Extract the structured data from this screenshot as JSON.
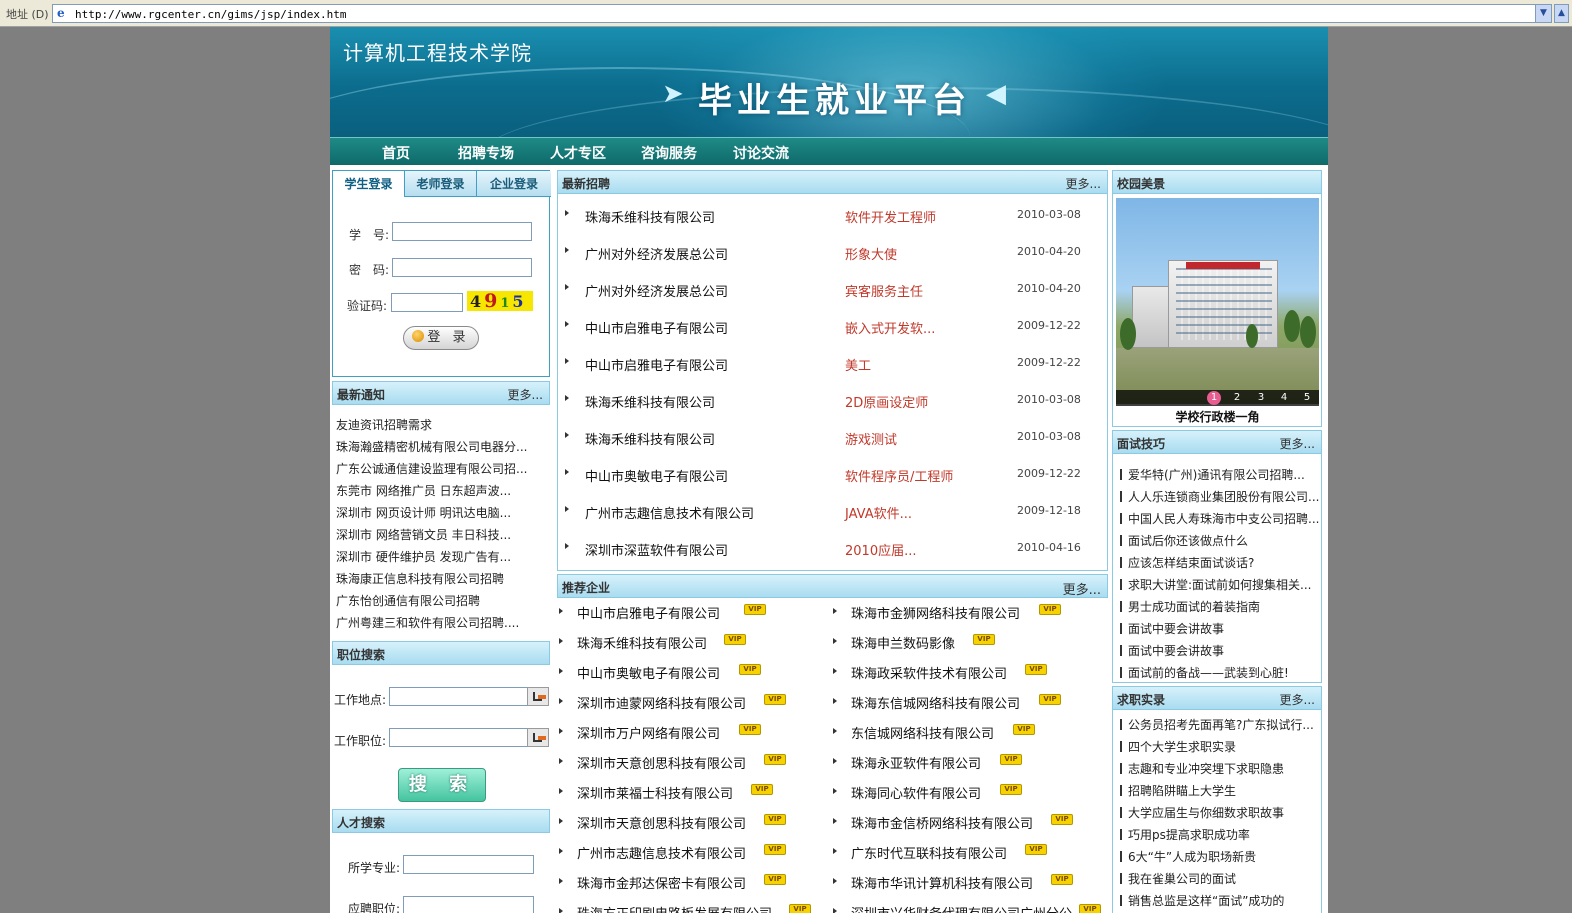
{
  "browser": {
    "address_label": "地址 (D)",
    "url": "http://www.rgcenter.cn/gims/jsp/index.htm"
  },
  "banner": {
    "school_name": "计算机工程技术学院",
    "platform_title": "毕业生就业平台"
  },
  "nav": {
    "items": [
      "首页",
      "招聘专场",
      "人才专区",
      "咨询服务",
      "讨论交流"
    ]
  },
  "login": {
    "tabs": [
      "学生登录",
      "老师登录",
      "企业登录"
    ],
    "student_id_label": "学　号:",
    "password_label": "密　码:",
    "captcha_label": "验证码:",
    "captcha_text": "4915",
    "login_button": "登 录"
  },
  "notices": {
    "title": "最新通知",
    "more": "更多...",
    "items": [
      "友迪资讯招聘需求",
      "珠海瀚盛精密机械有限公司电器分...",
      "广东公诚通信建设监理有限公司招...",
      "东莞市  网络推广员  日东超声波...",
      "深圳市  网页设计师  明讯达电脑...",
      "深圳市  网络营销文员  丰日科技...",
      "深圳市  硬件维护员  发现广告有...",
      "珠海康正信息科技有限公司招聘",
      "广东怡创通信有限公司招聘",
      "广州粤建三和软件有限公司招聘...."
    ]
  },
  "job_search": {
    "title": "职位搜索",
    "location_label": "工作地点:",
    "position_label": "工作职位:",
    "search_button": "搜 索"
  },
  "talent_search": {
    "title": "人才搜索",
    "major_label": "所学专业:",
    "apply_label": "应聘职位:"
  },
  "latest_jobs": {
    "title": "最新招聘",
    "more": "更多...",
    "rows": [
      {
        "company": "珠海禾维科技有限公司",
        "position": "软件开发工程师",
        "date": "2010-03-08"
      },
      {
        "company": "广州对外经济发展总公司",
        "position": "形象大使",
        "date": "2010-04-20"
      },
      {
        "company": "广州对外经济发展总公司",
        "position": "宾客服务主任",
        "date": "2010-04-20"
      },
      {
        "company": "中山市启雅电子有限公司",
        "position": "嵌入式开发软...",
        "date": "2009-12-22"
      },
      {
        "company": "中山市启雅电子有限公司",
        "position": "美工",
        "date": "2009-12-22"
      },
      {
        "company": "珠海禾维科技有限公司",
        "position": "2D原画设定师",
        "date": "2010-03-08"
      },
      {
        "company": "珠海禾维科技有限公司",
        "position": "游戏测试",
        "date": "2010-03-08"
      },
      {
        "company": "中山市奥敏电子有限公司",
        "position": "软件程序员/工程师",
        "date": "2009-12-22"
      },
      {
        "company": "广州市志趣信息技术有限公司",
        "position": "JAVA软件...",
        "date": "2009-12-18"
      },
      {
        "company": "深圳市深蓝软件有限公司",
        "position": "2010应届...",
        "date": "2010-04-16"
      }
    ]
  },
  "recommended": {
    "title": "推荐企业",
    "more": "更多...",
    "vip_label": "VIP",
    "left": [
      "中山市启雅电子有限公司",
      "珠海禾维科技有限公司",
      "中山市奥敏电子有限公司",
      "深圳市迪蒙网络科技有限公司",
      "深圳市万户网络有限公司",
      "深圳市天意创思科技有限公司",
      "深圳市莱福士科技有限公司",
      "深圳市天意创思科技有限公司",
      "广州市志趣信息技术有限公司",
      "珠海市金邦达保密卡有限公司",
      "珠海方正印刷电路板发展有限公司"
    ],
    "right": [
      "珠海市金狮网络科技有限公司",
      "珠海申兰数码影像",
      "珠海政采软件技术有限公司",
      "珠海东信城网络科技有限公司",
      "东信城网络科技有限公司",
      "珠海永亚软件有限公司",
      "珠海同心软件有限公司",
      "珠海市金信桥网络科技有限公司",
      "广东时代互联科技有限公司",
      "珠海市华讯计算机科技有限公司",
      "深圳市兴华财务代理有限公司广州分公"
    ]
  },
  "campus": {
    "title": "校园美景",
    "slides": [
      "1",
      "2",
      "3",
      "4",
      "5"
    ],
    "caption": "学校行政楼一角"
  },
  "interview": {
    "title": "面试技巧",
    "more": "更多...",
    "items": [
      "爱华特(广州)通讯有限公司招聘...",
      "人人乐连锁商业集团股份有限公司...",
      "中国人民人寿珠海市中支公司招聘...",
      "面试后你还该做点什么",
      "应该怎样结束面试谈话?",
      "求职大讲堂:面试前如何搜集相关...",
      "男士成功面试的着装指南",
      "面试中要会讲故事",
      "面试中要会讲故事",
      "面试前的备战——武装到心脏!"
    ]
  },
  "job_stories": {
    "title": "求职实录",
    "more": "更多...",
    "items": [
      "公务员招考先面再笔?广东拟试行...",
      "四个大学生求职实录",
      "志趣和专业冲突埋下求职隐患",
      "招聘陷阱瞄上大学生",
      "大学应届生与你细数求职故事",
      "巧用ps提高求职成功率",
      "6大“牛”人成为职场新贵",
      "我在雀巢公司的面试",
      "销售总监是这样“面试”成功的"
    ]
  }
}
